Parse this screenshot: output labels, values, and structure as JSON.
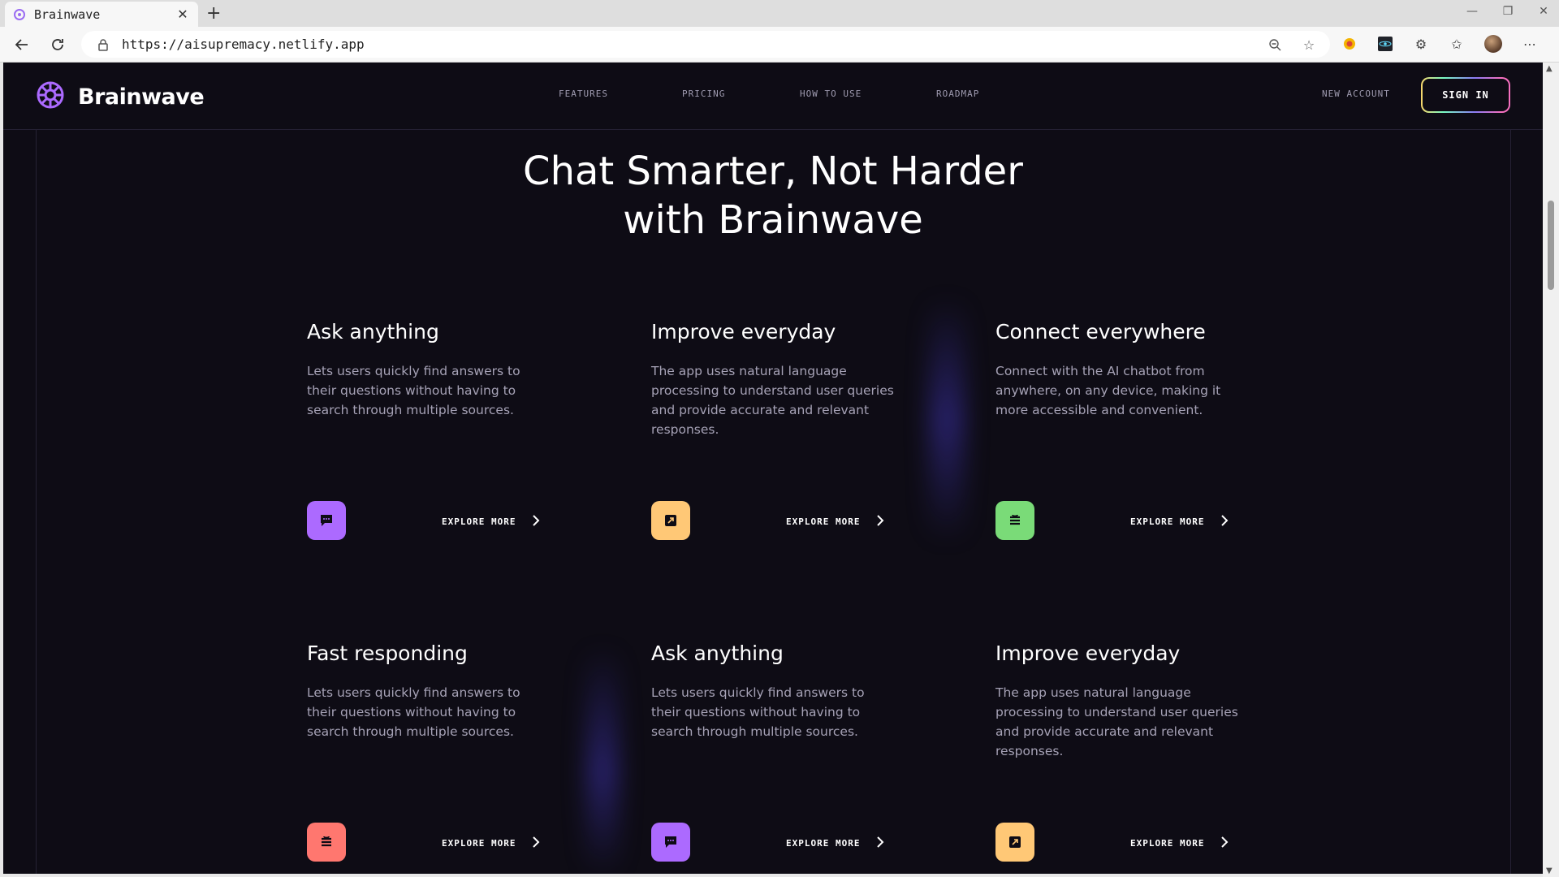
{
  "browser": {
    "tab_title": "Brainwave",
    "url": "https://aisupremacy.netlify.app"
  },
  "site": {
    "logo_text": "Brainwave",
    "nav": [
      "FEATURES",
      "PRICING",
      "HOW TO USE",
      "ROADMAP"
    ],
    "new_account": "NEW ACCOUNT",
    "sign_in": "SIGN IN"
  },
  "hero": {
    "line1": "Chat Smarter, Not Harder",
    "line2": "with Brainwave"
  },
  "cards": [
    {
      "title": "Ask anything",
      "text": "Lets users quickly find answers to their questions without having to search through multiple sources.",
      "icon": "chat-icon",
      "icon_color": "#ac6aff",
      "cta": "EXPLORE MORE"
    },
    {
      "title": "Improve everyday",
      "text": "The app uses natural language processing to understand user queries and provide accurate and relevant responses.",
      "icon": "expand-icon",
      "icon_color": "#ffc876",
      "cta": "EXPLORE MORE"
    },
    {
      "title": "Connect everywhere",
      "text": "Connect with the AI chatbot from anywhere, on any device, making it more accessible and convenient.",
      "icon": "stack-icon",
      "icon_color": "#7adb78",
      "cta": "EXPLORE MORE"
    },
    {
      "title": "Fast responding",
      "text": "Lets users quickly find answers to their questions without having to search through multiple sources.",
      "icon": "stack-icon",
      "icon_color": "#ff776f",
      "cta": "EXPLORE MORE"
    },
    {
      "title": "Ask anything",
      "text": "Lets users quickly find answers to their questions without having to search through multiple sources.",
      "icon": "chat-icon",
      "icon_color": "#ac6aff",
      "cta": "EXPLORE MORE"
    },
    {
      "title": "Improve everyday",
      "text": "The app uses natural language processing to understand user queries and provide accurate and relevant responses.",
      "icon": "expand-icon",
      "icon_color": "#ffc876",
      "cta": "EXPLORE MORE"
    }
  ]
}
